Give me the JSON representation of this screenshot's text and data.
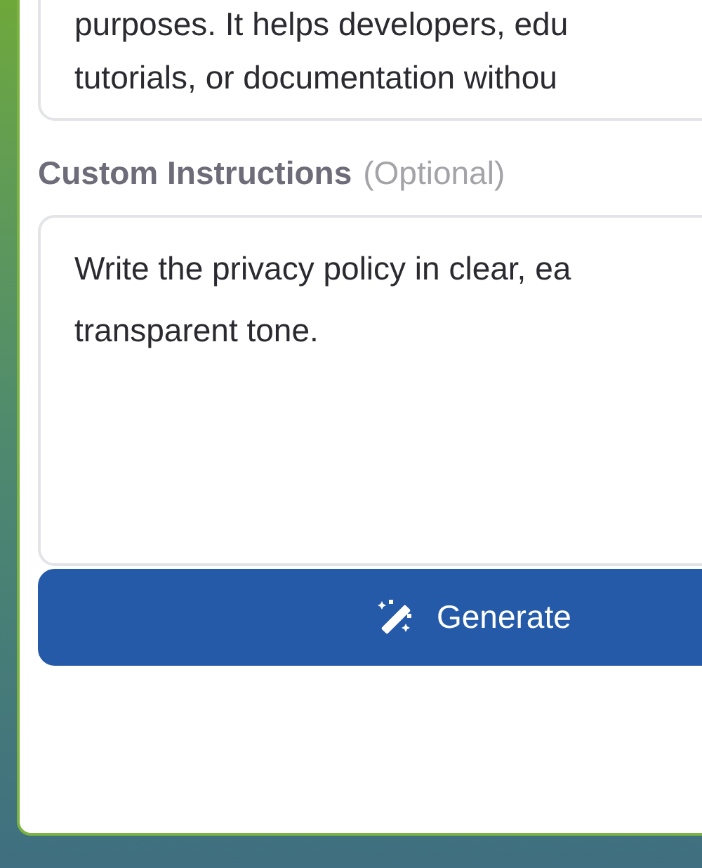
{
  "description_field": {
    "value_lines": [
      "purposes. It helps developers, edu",
      "tutorials, or documentation withou"
    ]
  },
  "custom_instructions": {
    "label": "Custom Instructions",
    "hint": "(Optional)",
    "value_lines": [
      "Write the privacy policy in clear, ea",
      "transparent tone."
    ]
  },
  "generate_button": {
    "label": "Generate"
  }
}
